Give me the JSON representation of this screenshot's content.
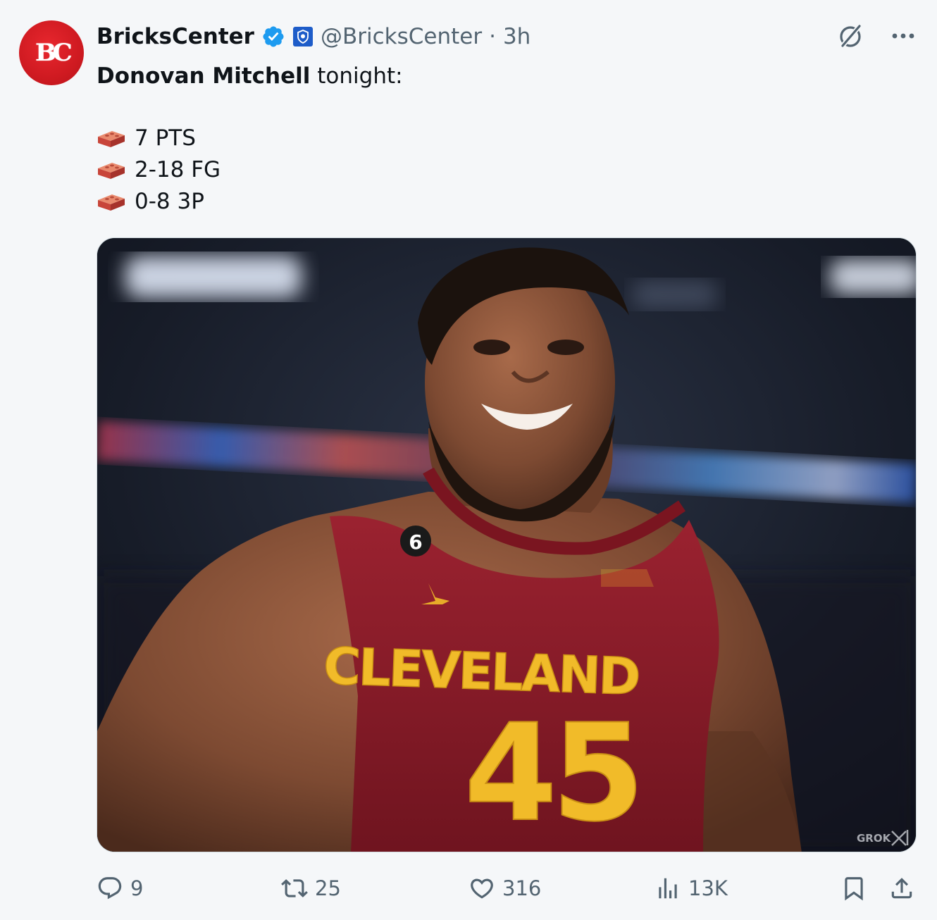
{
  "tweet": {
    "author": {
      "avatar_text": "BC",
      "display_name": "BricksCenter",
      "handle": "@BricksCenter",
      "separator": "·",
      "time": "3h"
    },
    "text": {
      "player": "Donovan Mitchell",
      "suffix": " tonight:",
      "stats": [
        "7 PTS",
        "2-18 FG",
        "0-8 3P"
      ]
    },
    "media": {
      "jersey_city": "CLEVELAND",
      "jersey_number": "45",
      "patch_number": "6",
      "watermark": "GROK"
    },
    "engagement": {
      "replies": "9",
      "reposts": "25",
      "likes": "316",
      "views": "13K"
    }
  },
  "icons": {
    "verified": "verified-badge-icon",
    "affiliate": "affiliate-shield-icon",
    "grok": "grok-icon",
    "more": "more-icon",
    "stat_emoji": "brick-icon",
    "reply": "reply-icon",
    "repost": "repost-icon",
    "like": "heart-icon",
    "views": "views-icon",
    "bookmark": "bookmark-icon",
    "share": "share-icon"
  },
  "colors": {
    "verified_blue": "#1d9bf0",
    "text_primary": "#0f1419",
    "text_secondary": "#536471",
    "brand_red": "#d21f26",
    "jersey_wine": "#8e1c26",
    "jersey_gold": "#f1bb29"
  }
}
